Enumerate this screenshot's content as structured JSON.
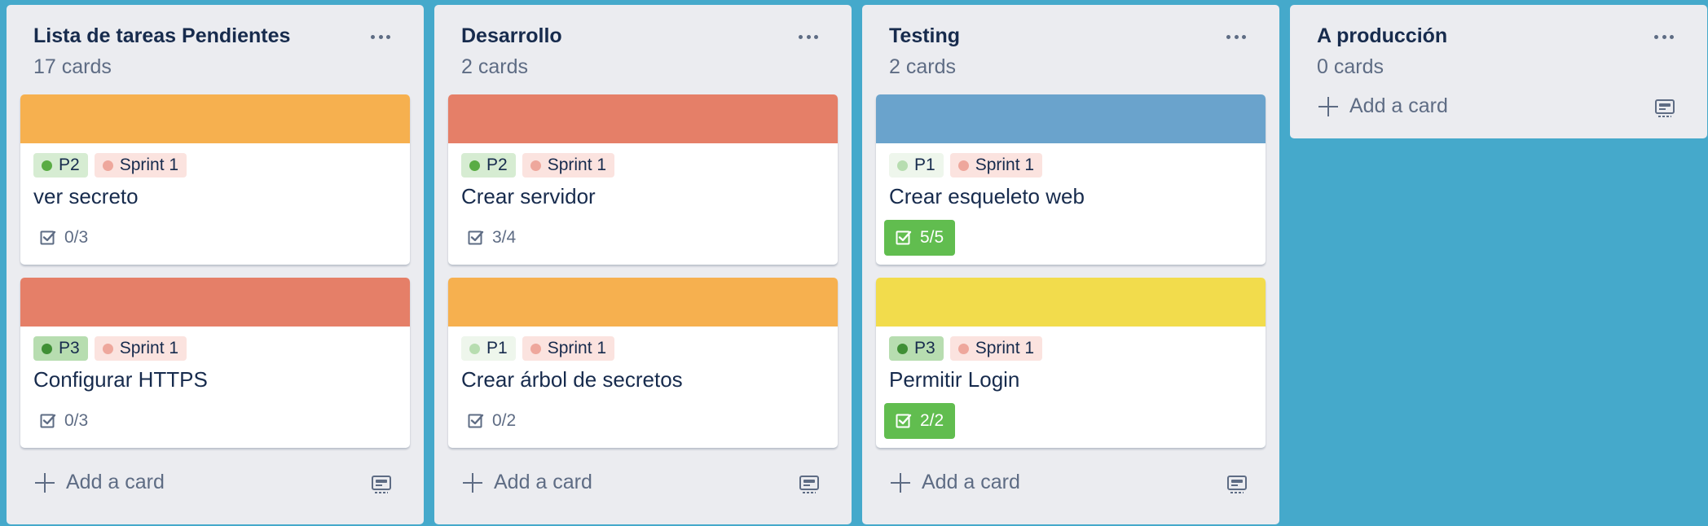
{
  "lists": [
    {
      "title": "Lista de tareas Pendientes",
      "count": "17 cards",
      "add_label": "Add a card",
      "cards": [
        {
          "cover": "#f6b04f",
          "labels": [
            {
              "text": "P2",
              "bg": "#d6ecd2",
              "dot": "#5aac44"
            },
            {
              "text": "Sprint 1",
              "bg": "#fbe3df",
              "dot": "#eea79c"
            }
          ],
          "title": "ver secreto",
          "badge": "0/3",
          "done": false
        },
        {
          "cover": "#e57f68",
          "labels": [
            {
              "text": "P3",
              "bg": "#b7ddb0",
              "dot": "#3f8f35"
            },
            {
              "text": "Sprint 1",
              "bg": "#fbe3df",
              "dot": "#eea79c"
            }
          ],
          "title": "Configurar HTTPS",
          "badge": "0/3",
          "done": false
        }
      ]
    },
    {
      "title": "Desarrollo",
      "count": "2 cards",
      "add_label": "Add a card",
      "cards": [
        {
          "cover": "#e57f68",
          "labels": [
            {
              "text": "P2",
              "bg": "#d6ecd2",
              "dot": "#5aac44"
            },
            {
              "text": "Sprint 1",
              "bg": "#fbe3df",
              "dot": "#eea79c"
            }
          ],
          "title": "Crear servidor",
          "badge": "3/4",
          "done": false
        },
        {
          "cover": "#f6b04f",
          "labels": [
            {
              "text": "P1",
              "bg": "#eef6ec",
              "dot": "#b7ddb0"
            },
            {
              "text": "Sprint 1",
              "bg": "#fbe3df",
              "dot": "#eea79c"
            }
          ],
          "title": "Crear árbol de secretos",
          "badge": "0/2",
          "done": false
        }
      ]
    },
    {
      "title": "Testing",
      "count": "2 cards",
      "add_label": "Add a card",
      "cards": [
        {
          "cover": "#6aa3cc",
          "labels": [
            {
              "text": "P1",
              "bg": "#eef6ec",
              "dot": "#b7ddb0"
            },
            {
              "text": "Sprint 1",
              "bg": "#fbe3df",
              "dot": "#eea79c"
            }
          ],
          "title": "Crear esqueleto web",
          "badge": "5/5",
          "done": true
        },
        {
          "cover": "#f2dc4c",
          "labels": [
            {
              "text": "P3",
              "bg": "#b7ddb0",
              "dot": "#3f8f35"
            },
            {
              "text": "Sprint 1",
              "bg": "#fbe3df",
              "dot": "#eea79c"
            }
          ],
          "title": "Permitir Login",
          "badge": "2/2",
          "done": true
        }
      ]
    },
    {
      "title": "A producción",
      "count": "0 cards",
      "add_label": "Add a card",
      "cards": []
    }
  ],
  "icons": {
    "list_menu": "ellipsis-icon",
    "add": "plus-icon",
    "template": "card-template-icon",
    "checklist": "checklist-icon"
  }
}
